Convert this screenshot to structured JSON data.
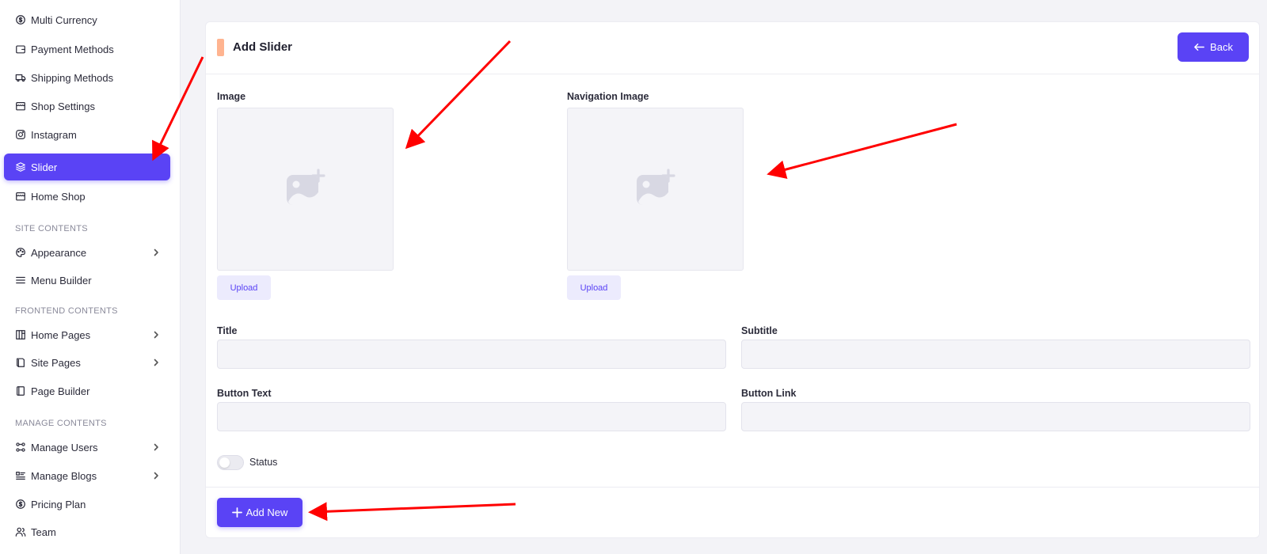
{
  "sidebar": {
    "items": [
      {
        "label": "Multi Currency",
        "icon": "currency-icon"
      },
      {
        "label": "Payment Methods",
        "icon": "wallet-icon"
      },
      {
        "label": "Shipping Methods",
        "icon": "truck-icon"
      },
      {
        "label": "Shop Settings",
        "icon": "store-icon"
      },
      {
        "label": "Instagram",
        "icon": "instagram-icon"
      },
      {
        "label": "Slider",
        "icon": "layers-icon",
        "active": true
      },
      {
        "label": "Home Shop",
        "icon": "store-icon"
      },
      {
        "label": "Appearance",
        "icon": "palette-icon"
      },
      {
        "label": "Menu Builder",
        "icon": "menu-icon"
      },
      {
        "label": "Home Pages",
        "icon": "pages-icon"
      },
      {
        "label": "Site Pages",
        "icon": "book-icon"
      },
      {
        "label": "Page Builder",
        "icon": "notebook-icon"
      },
      {
        "label": "Manage Users",
        "icon": "users-icon"
      },
      {
        "label": "Manage Blogs",
        "icon": "list-icon"
      },
      {
        "label": "Pricing Plan",
        "icon": "dollar-icon"
      },
      {
        "label": "Team",
        "icon": "team-icon"
      }
    ],
    "sections": {
      "site": "SITE CONTENTS",
      "frontend": "FRONTEND CONTENTS",
      "manage": "MANAGE CONTENTS"
    }
  },
  "form": {
    "title": "Add Slider",
    "back_label": "Back",
    "image_label": "Image",
    "nav_image_label": "Navigation Image",
    "upload_label": "Upload",
    "title_label": "Title",
    "title_value": "",
    "subtitle_label": "Subtitle",
    "subtitle_value": "",
    "button_text_label": "Button Text",
    "button_text_value": "",
    "button_link_label": "Button Link",
    "button_link_value": "",
    "status_label": "Status",
    "status_on": false,
    "add_label": "Add New"
  },
  "colors": {
    "accent": "#5a43f5",
    "header_bar": "#ffb490",
    "annotation_arrow": "#ff0000"
  }
}
